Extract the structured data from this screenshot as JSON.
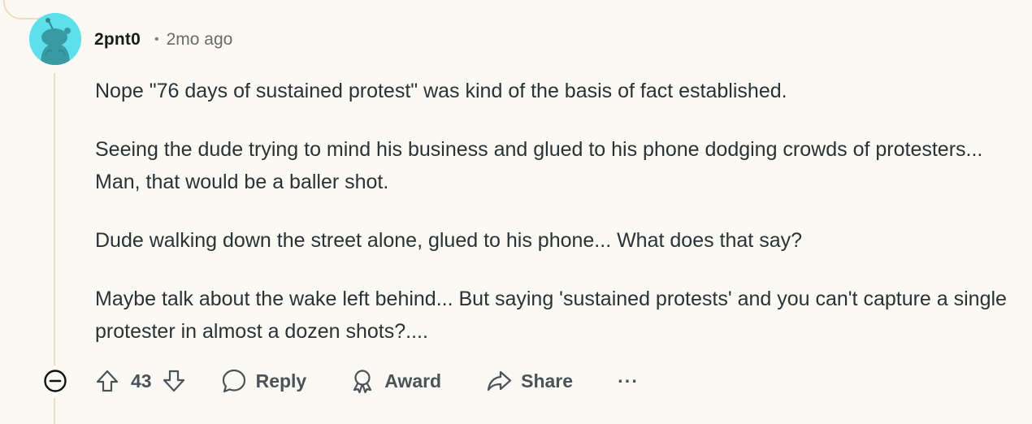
{
  "comment": {
    "author": "2pnt0",
    "separator": "•",
    "timestamp": "2mo ago",
    "paragraphs": [
      "Nope \"76 days of sustained protest\" was kind of the basis of fact established.",
      "Seeing the dude trying to mind his business and glued to his phone dodging crowds of protesters... Man, that would be a baller shot.",
      "Dude walking down the street alone, glued to his phone... What does that say?",
      "Maybe talk about the wake left behind... But saying 'sustained protests' and you can't capture a single protester in almost a dozen shots?...."
    ]
  },
  "actions": {
    "collapse_icon": "collapse-minus-icon",
    "upvote_icon": "upvote-arrow-icon",
    "score": "43",
    "downvote_icon": "downvote-arrow-icon",
    "reply_label": "Reply",
    "reply_icon": "speech-bubble-icon",
    "award_label": "Award",
    "award_icon": "award-medal-icon",
    "share_label": "Share",
    "share_icon": "share-arrow-icon",
    "more_label": "···"
  },
  "colors": {
    "background": "#fbf9f4",
    "avatar_bg": "#5ee0ec",
    "thread_line": "#efdcb8",
    "text": "#2a3236",
    "meta": "#6b6a6a"
  }
}
